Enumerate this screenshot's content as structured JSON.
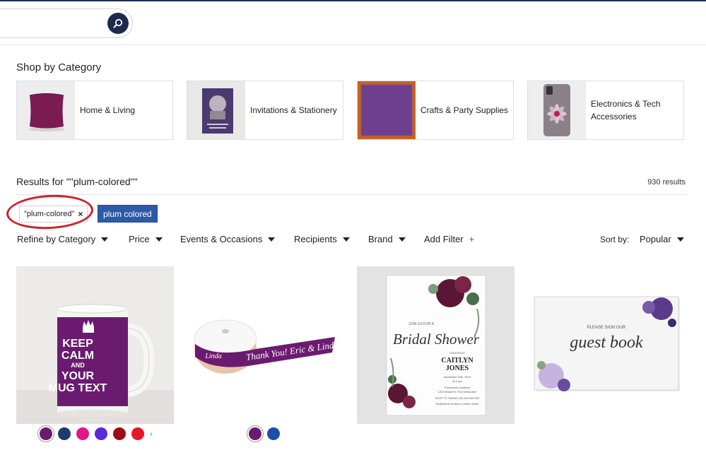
{
  "search": {
    "placeholder": "",
    "value": ""
  },
  "shop_by_category": {
    "title": "Shop by Category",
    "items": [
      {
        "label": "Home & Living"
      },
      {
        "label": "Invitations & Stationery"
      },
      {
        "label": "Crafts & Party Supplies"
      },
      {
        "label": "Electronics & Tech Accessories"
      }
    ]
  },
  "results": {
    "title": "Results for \"\"plum-colored\"\"",
    "count": "930 results",
    "active_chip": "\"plum-colored\"",
    "chip_remove": "×",
    "suggestion": "plum colored"
  },
  "filters": {
    "refine_category": "Refine by Category",
    "price": "Price",
    "events": "Events & Occasions",
    "recipients": "Recipients",
    "brand": "Brand",
    "add_filter": "Add Filter",
    "add_symbol": "+",
    "sort_label": "Sort by:",
    "sort_value": "Popular"
  },
  "products": [
    {
      "lines": [
        "KEEP",
        "CALM",
        "AND",
        "YOUR",
        "MUG TEXT"
      ],
      "swatches": [
        "#6b1b6f",
        "#1e3a6e",
        "#e0168a",
        "#5b2ad8",
        "#9c0e14",
        "#e3192a"
      ]
    },
    {
      "text": "Thank You! Eric & Linda",
      "text_short": "Linda",
      "swatches": [
        "#6b1b6f",
        "#1e4fa6"
      ]
    },
    {
      "small": "JOIN US FOR A",
      "script": "Bridal Shower",
      "honoring": "HONORING",
      "name1": "CAITLYN",
      "name2": "JONES",
      "details": [
        "November 20th, 2023",
        "At 2 pm"
      ],
      "venue": [
        "Punchbowl Canteen",
        "1234 Bridal St, Port Melbourne"
      ],
      "rsvp": "RSVP TO SARAH ON 000 000 000",
      "registry": "Registered at Myer & David Jones"
    },
    {
      "small": "PLEASE SIGN OUR",
      "script": "guest book"
    }
  ]
}
